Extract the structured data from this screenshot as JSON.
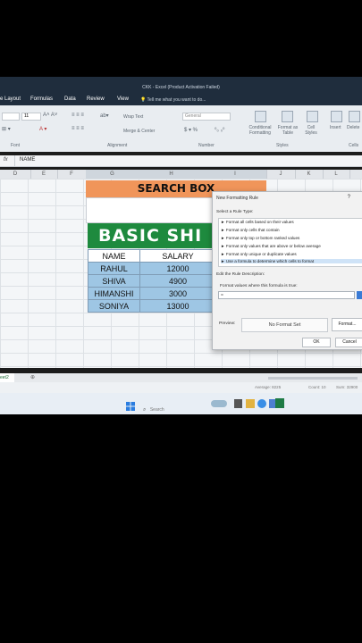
{
  "window": {
    "title": "CKK - Excel (Product Activation Failed)"
  },
  "menu": {
    "items": [
      "e Layout",
      "Formulas",
      "Data",
      "Review",
      "View"
    ],
    "tell_me": "Tell me what you want to do..."
  },
  "ribbon": {
    "font_size": "11",
    "wrap_text": "Wrap Text",
    "merge_center": "Merge & Center",
    "number_format": "General",
    "group_font": "Font",
    "group_alignment": "Alignment",
    "group_number": "Number",
    "group_styles": "Styles",
    "group_cells": "Cells",
    "conditional_formatting": "Conditional Formatting",
    "format_as_table": "Format as Table",
    "cell_styles": "Cell Styles",
    "insert": "Insert",
    "delete": "Delete"
  },
  "formula_bar": {
    "fx": "fx",
    "value": "NAME"
  },
  "columns": [
    "D",
    "E",
    "F",
    "G",
    "H",
    "I",
    "J",
    "K",
    "L"
  ],
  "sheet": {
    "search_box_label": "SEARCH BOX",
    "banner": "BASIC SHI",
    "headers": [
      "NAME",
      "SALARY"
    ],
    "rows": [
      [
        "RAHUL",
        "12000"
      ],
      [
        "SHIVA",
        "4900"
      ],
      [
        "HIMANSHI",
        "3000"
      ],
      [
        "SONIYA",
        "13000"
      ]
    ],
    "tab": "eet2"
  },
  "dialog": {
    "title": "New Formatting Rule",
    "close": "?",
    "select_rule_type": "Select a Rule Type:",
    "rule_types": [
      "► Format all cells based on their values",
      "► Format only cells that contain",
      "► Format only top or bottom ranked values",
      "► Format only values that are above or below average",
      "► Format only unique or duplicate values",
      "► Use a formula to determine which cells to format"
    ],
    "edit_rule_description": "Edit the Rule Description:",
    "formula_label": "Format values where this formula is true:",
    "formula_value": "=",
    "preview_label": "Preview:",
    "preview_text": "No Format Set",
    "format_button": "Format...",
    "ok_button": "OK",
    "cancel_button": "Cancel"
  },
  "statusbar": {
    "average": "Average: 8225",
    "count": "Count: 10",
    "sum": "Sum: 32900"
  },
  "taskbar": {
    "search_placeholder": "Search"
  }
}
